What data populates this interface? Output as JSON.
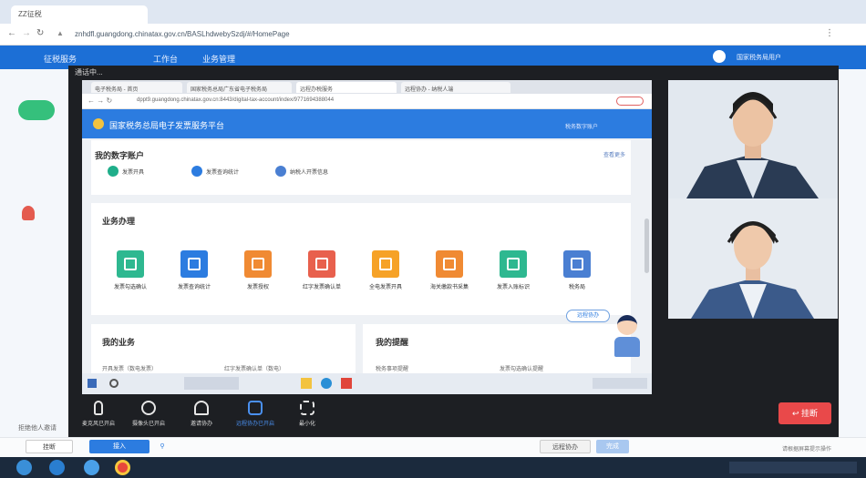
{
  "browser": {
    "tab_title": "ZZ征税",
    "url": "znhdfl.guangdong.chinatax.gov.cn/BASLhdwebySzdj/#/HomePage"
  },
  "app_header": {
    "brand": "征税服务",
    "nav": [
      "工作台",
      "业务管理"
    ],
    "user": "国家税务局用户"
  },
  "modal": {
    "title": "通话中..."
  },
  "inner_browser": {
    "tabs": [
      "电子税务局 - 首页",
      "国家税务总局广东省电子税务局",
      "远程办税服务",
      "远程协办 - 纳税人端"
    ],
    "url": "dppt9.guangdong.chinatax.gov.cn:8443/digital-tax-account/index/9771694388044"
  },
  "portal": {
    "title": "国家税务总局电子发票服务平台",
    "header_right": "税务数字账户"
  },
  "quick_card": {
    "title": "我的数字账户",
    "more": "查看更多",
    "items": [
      "发票开具",
      "发票查询统计",
      "纳税人开票信息"
    ],
    "colors": [
      "#1fae8a",
      "#2c7ce0",
      "#4a7fd2"
    ]
  },
  "service_card": {
    "title": "业务办理",
    "items": [
      "发票勾选确认",
      "发票查询统计",
      "发票授权",
      "红字发票确认单",
      "全电发票开具",
      "海关缴款书采集",
      "发票入账标识",
      "税务局"
    ],
    "colors": [
      "#2eb890",
      "#2c7ce0",
      "#f08a33",
      "#e8604d",
      "#f6a227",
      "#f08a33",
      "#2eb890",
      "#4a7fd2"
    ]
  },
  "bottom_cards": {
    "left": {
      "title": "我的业务",
      "line1": "开具发票（数电发票）",
      "line2": "红字发票确认单（数电）"
    },
    "right": {
      "title": "我的提醒",
      "line1": "税务事项提醒",
      "line2": "发票勾选确认提醒"
    }
  },
  "assistant": {
    "bubble": "远程协办"
  },
  "controls": [
    "麦克风已开启",
    "摄像头已开启",
    "邀请协办",
    "远程协办已开启",
    "最小化"
  ],
  "hangup": "挂断",
  "bottom": {
    "left_text": "拒绝他人邀请",
    "btn1": "挂断",
    "btn2": "接入",
    "btn3": "远程协办",
    "btn4": "完成",
    "right_text": "请根据屏幕提示操作"
  }
}
